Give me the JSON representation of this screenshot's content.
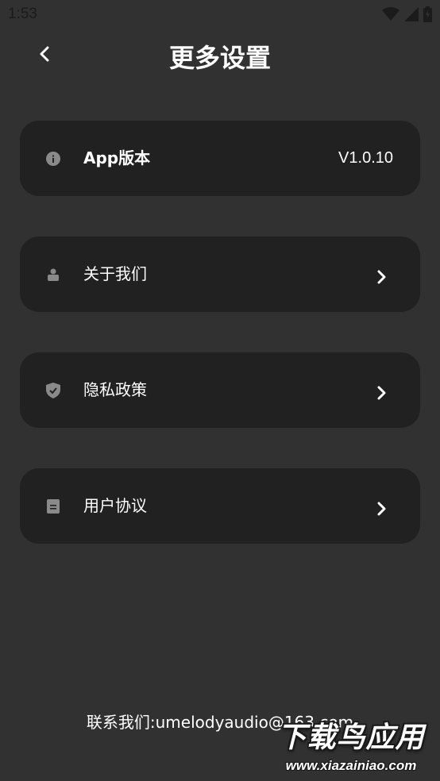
{
  "status_bar": {
    "time": "1:53",
    "icons": [
      "wifi-icon",
      "signal-icon",
      "battery-icon"
    ]
  },
  "header": {
    "back_icon": "chevron-left-icon",
    "title": "更多设置"
  },
  "settings": [
    {
      "icon": "info-icon",
      "label": "App版本",
      "value": "V1.0.10"
    },
    {
      "icon": "user-icon",
      "label": "关于我们",
      "chevron": "chevron-right-icon"
    },
    {
      "icon": "shield-icon",
      "label": "隐私政策",
      "chevron": "chevron-right-icon"
    },
    {
      "icon": "document-icon",
      "label": "用户协议",
      "chevron": "chevron-right-icon"
    }
  ],
  "contact": "联系我们:umelodyaudio@163.com",
  "watermark": {
    "title": "下载鸟应用",
    "url": "www.xiazainiao.com"
  },
  "colors": {
    "background": "#313131",
    "card": "#212121",
    "icon": "#8a8a8a",
    "text": "#ffffff"
  }
}
